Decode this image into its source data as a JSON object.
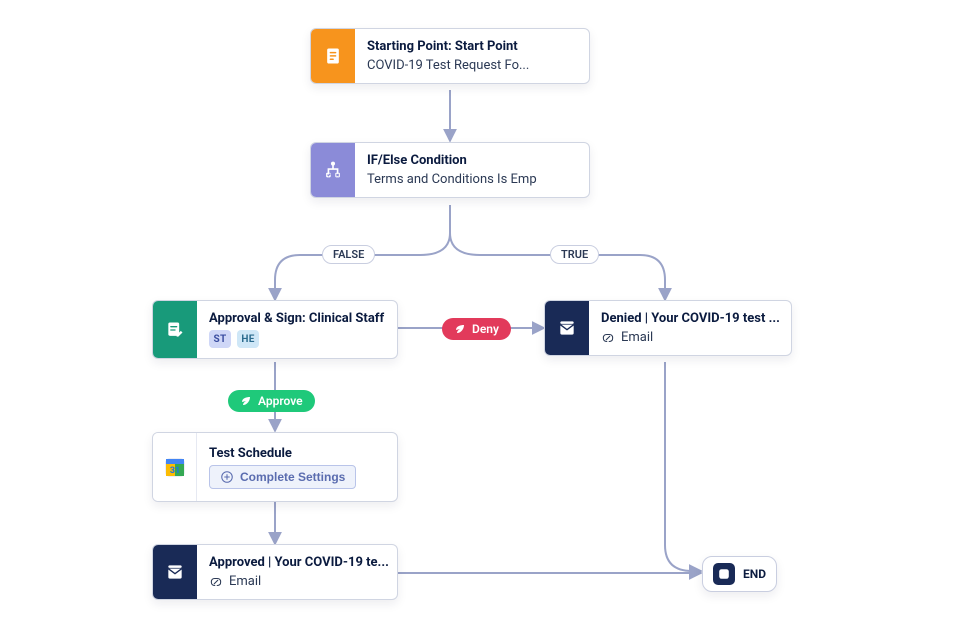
{
  "nodes": {
    "start": {
      "title": "Starting Point: Start Point",
      "subtitle": "COVID-19 Test Request Fo..."
    },
    "condition": {
      "title": "IF/Else Condition",
      "subtitle": "Terms and Conditions Is Emp"
    },
    "approval": {
      "title": "Approval & Sign: Clinical Staff",
      "badges": {
        "st": "ST",
        "he": "HE"
      }
    },
    "denied": {
      "title": "Denied | Your COVID-19 test ...",
      "subtitle": "Email"
    },
    "schedule": {
      "title": "Test Schedule",
      "action": "Complete Settings"
    },
    "approved": {
      "title": "Approved | Your COVID-19 te...",
      "subtitle": "Email"
    },
    "end": {
      "label": "END"
    }
  },
  "labels": {
    "false": "FALSE",
    "true": "TRUE",
    "approve": "Approve",
    "deny": "Deny"
  },
  "colors": {
    "orange": "#f7941d",
    "purple": "#8b8bd8",
    "green": "#189a7a",
    "navy": "#192a56",
    "approve": "#1fc97a",
    "deny": "#e23a5b",
    "wire": "#9aa3c8"
  }
}
